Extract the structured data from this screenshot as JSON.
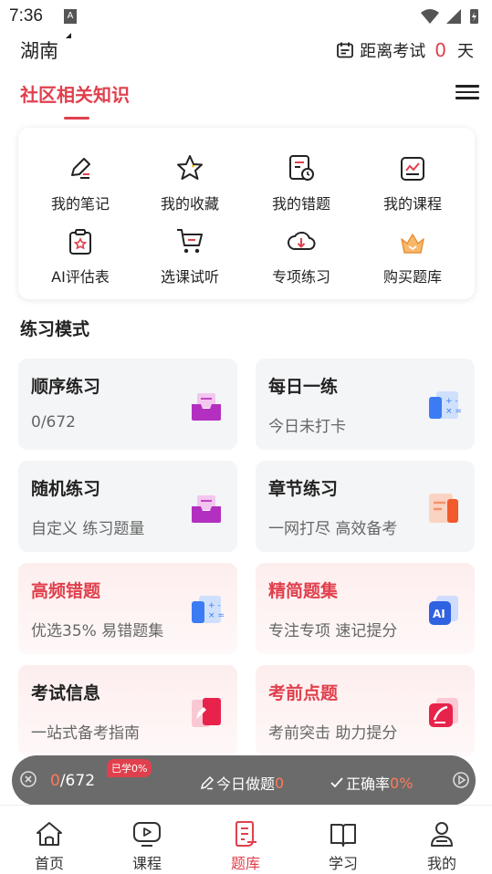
{
  "status_bar": {
    "time": "7:36",
    "notif_icon": "A"
  },
  "header": {
    "region": "湖南",
    "exam_prefix": "距离考试",
    "exam_days": "0",
    "exam_suffix": "天"
  },
  "tab": {
    "title": "社区相关知识"
  },
  "quick_items": [
    {
      "label": "我的笔记",
      "icon": "note-edit-icon"
    },
    {
      "label": "我的收藏",
      "icon": "star-icon"
    },
    {
      "label": "我的错题",
      "icon": "wrong-questions-icon"
    },
    {
      "label": "我的课程",
      "icon": "course-chart-icon"
    },
    {
      "label": "AI评估表",
      "icon": "clipboard-icon"
    },
    {
      "label": "选课试听",
      "icon": "cart-icon"
    },
    {
      "label": "专项练习",
      "icon": "cloud-download-icon"
    },
    {
      "label": "购买题库",
      "icon": "crown-icon"
    }
  ],
  "section": {
    "title": "练习模式"
  },
  "modes": [
    {
      "title": "顺序练习",
      "subtitle": "0/672",
      "style": "gray",
      "icon": "mail-tray-icon"
    },
    {
      "title": "每日一练",
      "subtitle": "今日未打卡",
      "style": "gray",
      "icon": "calculator-icon"
    },
    {
      "title": "随机练习",
      "subtitle": "自定义 练习题量",
      "style": "gray",
      "icon": "mail-tray-icon"
    },
    {
      "title": "章节练习",
      "subtitle": "一网打尽 高效备考",
      "style": "gray",
      "icon": "list-doc-icon"
    },
    {
      "title": "高频错题",
      "subtitle": "优选35% 易错题集",
      "style": "pink-red",
      "icon": "calculator-icon"
    },
    {
      "title": "精简题集",
      "subtitle": "专注专项 速记提分",
      "style": "pink-red",
      "icon": "ai-card-icon"
    },
    {
      "title": "考试信息",
      "subtitle": "一站式备考指南",
      "style": "pink",
      "icon": "edit-card-icon"
    },
    {
      "title": "考前点题",
      "subtitle": "考前突击 助力提分",
      "style": "pink-red",
      "icon": "curve-card-icon"
    }
  ],
  "floating_bar": {
    "done": "0",
    "total": "/672",
    "badge": "已学0%",
    "today_label": "今日做题",
    "today_value": "0",
    "rate_label": "正确率",
    "rate_value": "0%"
  },
  "bottom_nav": [
    {
      "label": "首页",
      "icon": "home-icon",
      "active": false
    },
    {
      "label": "课程",
      "icon": "play-icon",
      "active": false
    },
    {
      "label": "题库",
      "icon": "question-bank-icon",
      "active": true
    },
    {
      "label": "学习",
      "icon": "book-icon",
      "active": false
    },
    {
      "label": "我的",
      "icon": "user-icon",
      "active": false
    }
  ],
  "colors": {
    "accent": "#e0404d",
    "orange": "#ff7a59",
    "card_gray": "#f4f5f7"
  }
}
